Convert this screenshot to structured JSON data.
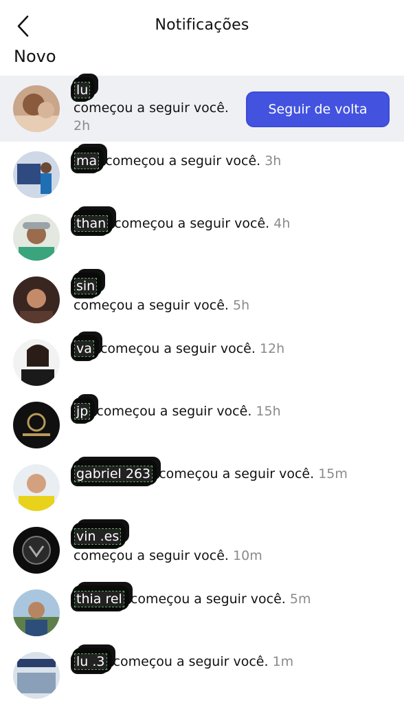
{
  "header": {
    "title": "Notificações"
  },
  "section_label": "Novo",
  "follow_back_label": "Seguir de volta",
  "icons": {
    "back": "chevron-left-icon"
  },
  "colors": {
    "accent": "#4353e0",
    "highlight_bg": "#eef0f4",
    "time": "#8a8a8a"
  },
  "notifications": [
    {
      "name": "lu",
      "text": "começou a seguir você.",
      "time": "2h"
    },
    {
      "name": "ma",
      "text": "começou a seguir você.",
      "time": "3h"
    },
    {
      "name": "than",
      "text": "começou a seguir você.",
      "time": "4h"
    },
    {
      "name": "sin",
      "text": "começou a seguir você.",
      "time": "5h"
    },
    {
      "name": "va",
      "text": "começou a seguir você.",
      "time": "12h"
    },
    {
      "name": "jp",
      "text": "começou a seguir você.",
      "time": "15h"
    },
    {
      "name": "gabriel 263",
      "text": "começou a seguir você.",
      "time": "15m"
    },
    {
      "name": "vin .es",
      "text": "começou a seguir você.",
      "time": "10m"
    },
    {
      "name": "thia rel",
      "text": "começou a seguir você.",
      "time": "5m"
    },
    {
      "name": "lu .3",
      "text": "começou a seguir você.",
      "time": "1m"
    }
  ]
}
